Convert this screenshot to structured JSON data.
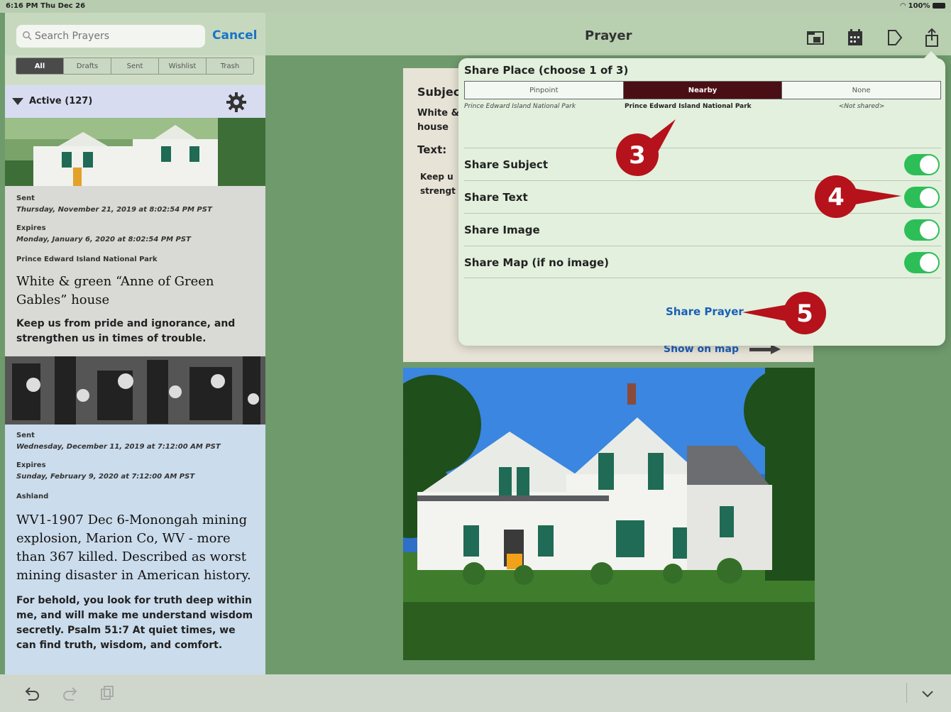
{
  "status": {
    "time": "6:16 PM  Thu Dec 26",
    "battery": "100%"
  },
  "search": {
    "placeholder": "Search Prayers",
    "cancel": "Cancel"
  },
  "filters": [
    {
      "label": "All",
      "active": true
    },
    {
      "label": "Drafts"
    },
    {
      "label": "Sent"
    },
    {
      "label": "Wishlist"
    },
    {
      "label": "Trash"
    }
  ],
  "group": {
    "label": "Active (127)"
  },
  "items": [
    {
      "sent_label": "Sent",
      "sent": "Thursday, November 21, 2019 at 8:02:54 PM PST",
      "expires_label": "Expires",
      "expires": "Monday, January 6, 2020 at 8:02:54 PM PST",
      "place": "Prince Edward Island National Park",
      "title": "White & green “Anne of Green Gables” house",
      "body": "Keep us from pride and ignorance, and strengthen us in times of trouble."
    },
    {
      "sent_label": "Sent",
      "sent": "Wednesday, December 11, 2019 at 7:12:00 AM PST",
      "expires_label": "Expires",
      "expires": "Sunday, February 9, 2020 at 7:12:00 AM PST",
      "place": "Ashland",
      "title": "WV1-1907 Dec 6-Monongah mining explosion, Marion Co, WV - more than 367 killed. Described as worst mining disaster in American history.",
      "body": "For behold, you look for truth deep within me, and will make me understand wisdom secretly. Psalm 51:7 At quiet times, we can find truth, wisdom, and comfort."
    }
  ],
  "main": {
    "title": "Prayer",
    "subject_label": "Subjec",
    "subject_line1": "White &",
    "subject_line2": "house",
    "text_label": "Text:",
    "text_line1": "Keep u",
    "text_line2": "strengt",
    "show_on_map": "Show on map"
  },
  "popover": {
    "title": "Share Place (choose 1 of 3)",
    "place_options": [
      "Pinpoint",
      "Nearby",
      "None"
    ],
    "place_selected": "Nearby",
    "place_values": [
      "Prince Edward Island National Park",
      "Prince Edward Island National Park",
      "<Not shared>"
    ],
    "toggles": [
      {
        "label": "Share Subject",
        "on": true
      },
      {
        "label": "Share Text",
        "on": true
      },
      {
        "label": "Share Image",
        "on": true
      },
      {
        "label": "Share Map (if no image)",
        "on": true
      }
    ],
    "share_button": "Share Prayer"
  },
  "callouts": {
    "c3": "3",
    "c4": "4",
    "c5": "5"
  },
  "colors": {
    "accent": "#1a5fb8",
    "callout": "#b5121b",
    "toggle_on": "#2dbe58",
    "selected_segment": "#4a0f14"
  }
}
